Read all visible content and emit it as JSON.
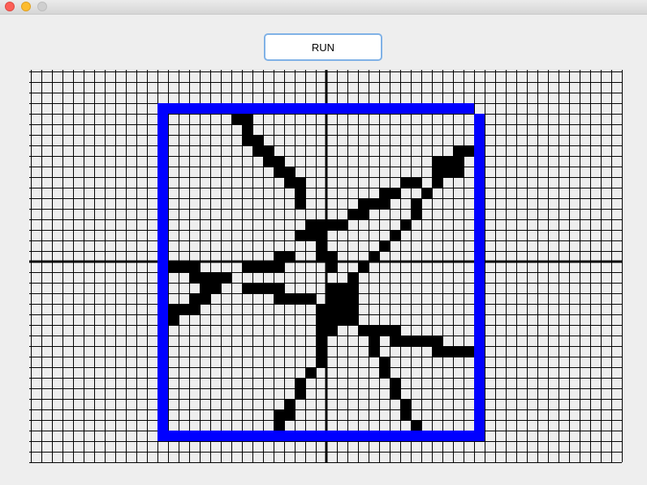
{
  "window": {
    "controls": [
      {
        "name": "close-button",
        "color": "#fc5f57"
      },
      {
        "name": "minimize-button",
        "color": "#fdbc2e"
      },
      {
        "name": "maximize-button",
        "color": "#cfcfcf"
      }
    ]
  },
  "toolbar": {
    "run_label": "RUN"
  },
  "canvas": {
    "grid_color": "#000000",
    "cell_fill_color": "#000000",
    "border_color": "#0000ff",
    "columns": 56,
    "rows": 37,
    "origin": {
      "col": 28,
      "row": 18
    },
    "border_cells": {
      "col_min": 12,
      "col_max": 42,
      "row_min": 3,
      "row_max": 34
    },
    "filled_cells": [
      [
        19,
        4
      ],
      [
        20,
        4
      ],
      [
        20,
        5
      ],
      [
        20,
        6
      ],
      [
        21,
        6
      ],
      [
        21,
        7
      ],
      [
        22,
        7
      ],
      [
        22,
        8
      ],
      [
        23,
        8
      ],
      [
        23,
        9
      ],
      [
        24,
        9
      ],
      [
        24,
        10
      ],
      [
        25,
        10
      ],
      [
        25,
        11
      ],
      [
        25,
        12
      ],
      [
        40,
        7
      ],
      [
        41,
        7
      ],
      [
        38,
        8
      ],
      [
        39,
        8
      ],
      [
        40,
        8
      ],
      [
        38,
        9
      ],
      [
        39,
        9
      ],
      [
        40,
        9
      ],
      [
        35,
        10
      ],
      [
        36,
        10
      ],
      [
        38,
        10
      ],
      [
        33,
        11
      ],
      [
        34,
        11
      ],
      [
        37,
        11
      ],
      [
        31,
        12
      ],
      [
        32,
        12
      ],
      [
        33,
        12
      ],
      [
        36,
        12
      ],
      [
        30,
        13
      ],
      [
        31,
        13
      ],
      [
        29,
        14
      ],
      [
        36,
        13
      ],
      [
        28,
        14
      ],
      [
        35,
        14
      ],
      [
        34,
        15
      ],
      [
        33,
        16
      ],
      [
        32,
        17
      ],
      [
        31,
        18
      ],
      [
        30,
        19
      ],
      [
        29,
        20
      ],
      [
        26,
        14
      ],
      [
        27,
        14
      ],
      [
        25,
        15
      ],
      [
        26,
        15
      ],
      [
        27,
        15
      ],
      [
        27,
        16
      ],
      [
        27,
        17
      ],
      [
        28,
        17
      ],
      [
        28,
        18
      ],
      [
        23,
        17
      ],
      [
        24,
        17
      ],
      [
        23,
        18
      ],
      [
        20,
        18
      ],
      [
        21,
        18
      ],
      [
        22,
        18
      ],
      [
        12,
        18
      ],
      [
        13,
        18
      ],
      [
        14,
        18
      ],
      [
        15,
        18
      ],
      [
        15,
        19
      ],
      [
        16,
        19
      ],
      [
        17,
        19
      ],
      [
        18,
        19
      ],
      [
        16,
        20
      ],
      [
        17,
        20
      ],
      [
        15,
        21
      ],
      [
        16,
        21
      ],
      [
        13,
        22
      ],
      [
        14,
        22
      ],
      [
        15,
        22
      ],
      [
        12,
        23
      ],
      [
        13,
        23
      ],
      [
        20,
        20
      ],
      [
        21,
        20
      ],
      [
        22,
        20
      ],
      [
        23,
        20
      ],
      [
        23,
        21
      ],
      [
        24,
        21
      ],
      [
        25,
        21
      ],
      [
        26,
        21
      ],
      [
        28,
        20
      ],
      [
        29,
        20
      ],
      [
        30,
        20
      ],
      [
        28,
        21
      ],
      [
        29,
        21
      ],
      [
        30,
        21
      ],
      [
        27,
        22
      ],
      [
        28,
        22
      ],
      [
        29,
        22
      ],
      [
        30,
        22
      ],
      [
        27,
        23
      ],
      [
        28,
        23
      ],
      [
        29,
        23
      ],
      [
        30,
        23
      ],
      [
        27,
        24
      ],
      [
        28,
        24
      ],
      [
        31,
        24
      ],
      [
        32,
        24
      ],
      [
        33,
        24
      ],
      [
        34,
        24
      ],
      [
        34,
        25
      ],
      [
        35,
        25
      ],
      [
        36,
        25
      ],
      [
        37,
        25
      ],
      [
        38,
        25
      ],
      [
        38,
        26
      ],
      [
        39,
        26
      ],
      [
        40,
        26
      ],
      [
        41,
        26
      ],
      [
        27,
        25
      ],
      [
        32,
        25
      ],
      [
        27,
        26
      ],
      [
        32,
        26
      ],
      [
        27,
        27
      ],
      [
        33,
        27
      ],
      [
        26,
        28
      ],
      [
        33,
        28
      ],
      [
        25,
        29
      ],
      [
        34,
        29
      ],
      [
        25,
        30
      ],
      [
        34,
        30
      ],
      [
        24,
        31
      ],
      [
        35,
        31
      ],
      [
        23,
        32
      ],
      [
        24,
        32
      ],
      [
        35,
        32
      ],
      [
        23,
        33
      ],
      [
        36,
        33
      ]
    ]
  }
}
